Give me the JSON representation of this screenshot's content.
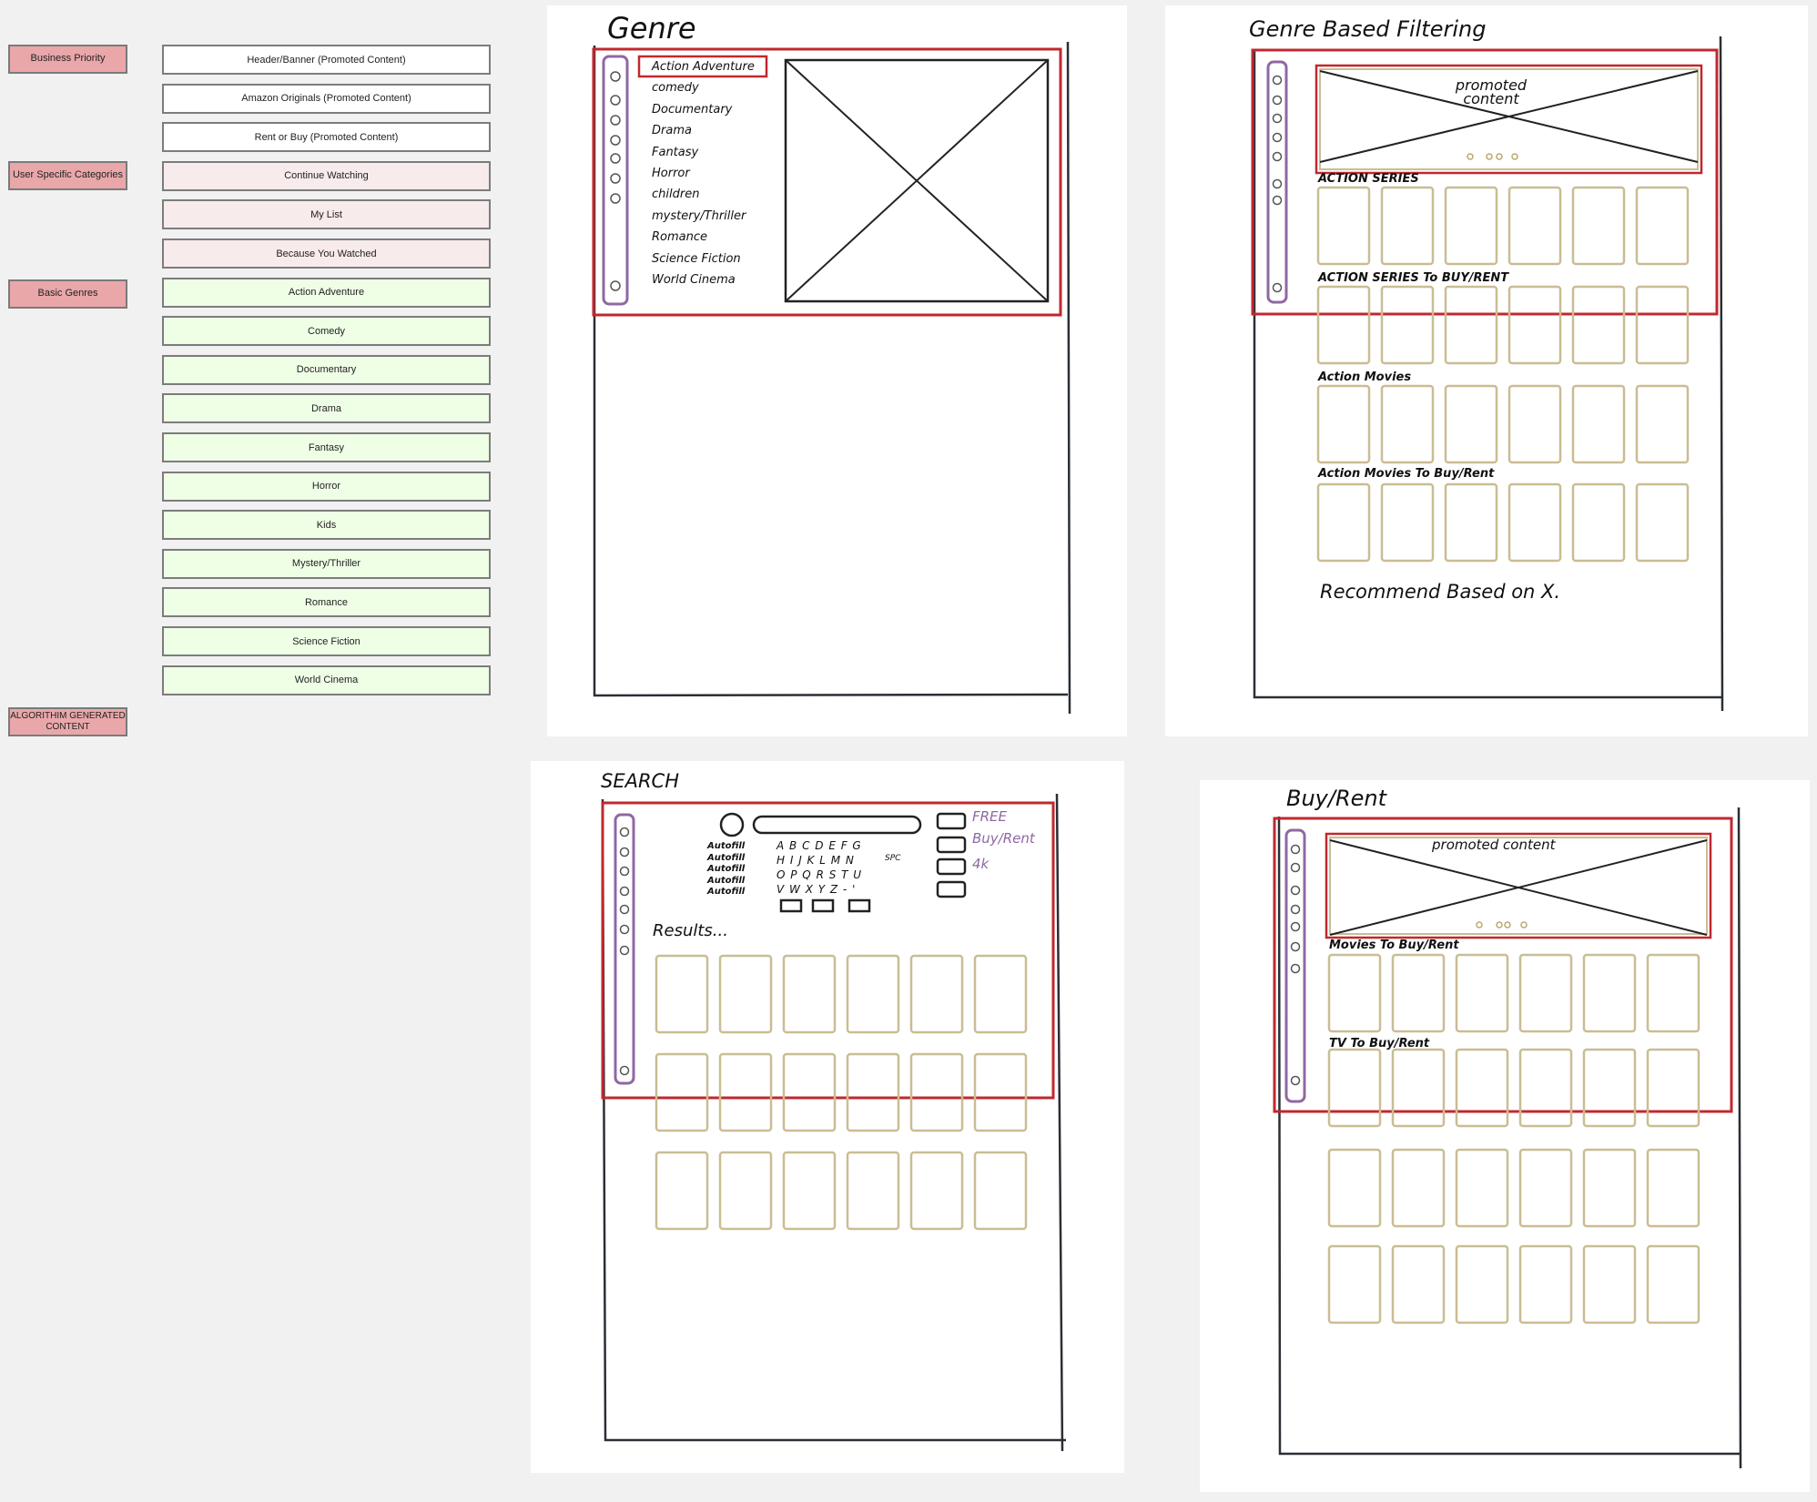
{
  "legend": {
    "categories": {
      "business": "Business Priority",
      "user": "User Specific Categories",
      "genres": "Basic Genres",
      "algo": "ALGORITHIM GENERATED CONTENT"
    },
    "items": [
      {
        "label": "Header/Banner (Promoted Content)",
        "group": "business"
      },
      {
        "label": "Amazon Originals (Promoted Content)",
        "group": "business"
      },
      {
        "label": "Rent or Buy (Promoted Content)",
        "group": "business"
      },
      {
        "label": "Continue Watching",
        "group": "user"
      },
      {
        "label": "My List",
        "group": "user"
      },
      {
        "label": "Because You Watched",
        "group": "user"
      },
      {
        "label": "Action Adventure",
        "group": "genre"
      },
      {
        "label": "Comedy",
        "group": "genre"
      },
      {
        "label": "Documentary",
        "group": "genre"
      },
      {
        "label": "Drama",
        "group": "genre"
      },
      {
        "label": "Fantasy",
        "group": "genre"
      },
      {
        "label": "Horror",
        "group": "genre"
      },
      {
        "label": "Kids",
        "group": "genre"
      },
      {
        "label": "Mystery/Thriller",
        "group": "genre"
      },
      {
        "label": "Romance",
        "group": "genre"
      },
      {
        "label": "Science Fiction",
        "group": "genre"
      },
      {
        "label": "World Cinema",
        "group": "genre"
      }
    ]
  },
  "sketches": {
    "genre": {
      "title": "Genre",
      "list": [
        "Action Adventure",
        "comedy",
        "Documentary",
        "Drama",
        "Fantasy",
        "Horror",
        "children",
        "mystery/Thriller",
        "Romance",
        "Science Fiction",
        "World Cinema"
      ]
    },
    "genre_filter": {
      "title": "Genre Based Filtering",
      "promo": "promoted content",
      "rows": [
        "ACTION SERIES",
        "ACTION SERIES To BUY/RENT",
        "Action Movies",
        "Action Movies To Buy/Rent"
      ],
      "footer": "Recommend Based on X."
    },
    "search": {
      "title": "SEARCH",
      "autofill": [
        "Autofill",
        "Autofill",
        "Autofill",
        "Autofill",
        "Autofill"
      ],
      "keys": [
        "A B C D E F G",
        "H I J K L M N",
        "O P Q R S T U",
        "V W X Y Z - '"
      ],
      "key_extra": "SPC",
      "filters": [
        "FREE",
        "Buy/Rent",
        "4k"
      ],
      "results": "Results..."
    },
    "buy_rent": {
      "title": "Buy/Rent",
      "promo": "promoted content",
      "rows": [
        "Movies To Buy/Rent",
        "TV To Buy/Rent"
      ]
    }
  },
  "colors": {
    "category_bg": "#e9a7aa",
    "user_item_bg": "#f8ebec",
    "genre_item_bg": "#efffe6",
    "highlight_red": "#c0282e",
    "sidebar_purple": "#8f68a3",
    "tile_tan": "#c9bd93"
  }
}
